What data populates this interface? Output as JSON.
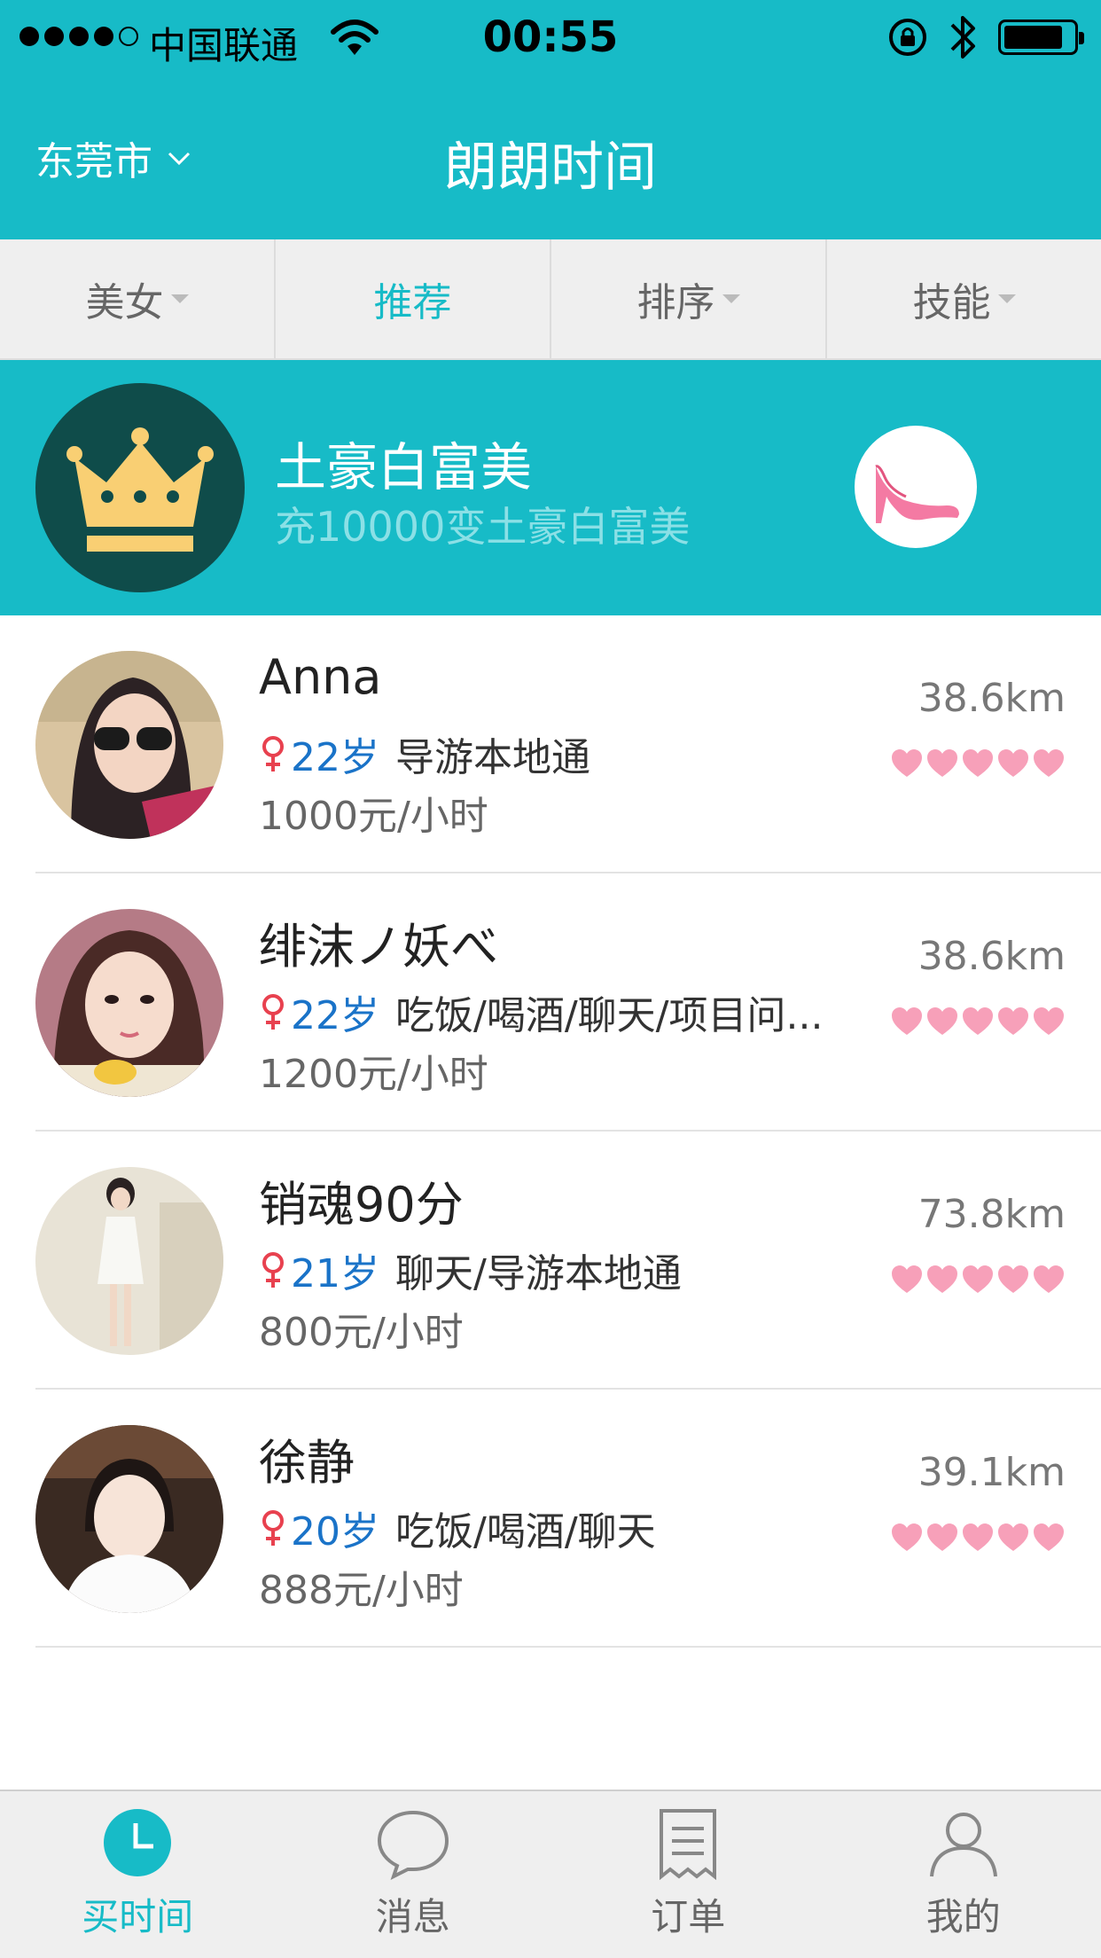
{
  "status": {
    "carrier": "中国联通",
    "time": "00:55",
    "battery_percent": 85
  },
  "header": {
    "city": "东莞市",
    "title": "朗朗时间"
  },
  "filters": [
    {
      "label": "美女",
      "has_dropdown": true,
      "active": false
    },
    {
      "label": "推荐",
      "has_dropdown": false,
      "active": true
    },
    {
      "label": "排序",
      "has_dropdown": true,
      "active": false
    },
    {
      "label": "技能",
      "has_dropdown": true,
      "active": false
    }
  ],
  "banner": {
    "title": "土豪白富美",
    "subtitle": "充10000变土豪白富美",
    "left_icon": "crown-icon",
    "right_icon": "high-heel-icon"
  },
  "profiles": [
    {
      "name": "Anna",
      "age": "22岁",
      "skills": "导游本地通",
      "price": "1000元/小时",
      "distance": "38.6km",
      "rating": 5
    },
    {
      "name": "绯沫ノ妖べ",
      "age": "22岁",
      "skills": "吃饭/喝酒/聊天/项目问...",
      "price": "1200元/小时",
      "distance": "38.6km",
      "rating": 5
    },
    {
      "name": "销魂90分",
      "age": "21岁",
      "skills": "聊天/导游本地通",
      "price": "800元/小时",
      "distance": "73.8km",
      "rating": 5
    },
    {
      "name": "徐静",
      "age": "20岁",
      "skills": "吃饭/喝酒/聊天",
      "price": "888元/小时",
      "distance": "39.1km",
      "rating": 5
    }
  ],
  "tabbar": [
    {
      "label": "买时间",
      "icon": "clock-icon",
      "active": true
    },
    {
      "label": "消息",
      "icon": "chat-bubble-icon",
      "active": false
    },
    {
      "label": "订单",
      "icon": "receipt-icon",
      "active": false
    },
    {
      "label": "我的",
      "icon": "person-icon",
      "active": false
    }
  ],
  "colors": {
    "brand": "#17bbc7",
    "heart": "#f7a0b9",
    "age": "#1a73c8",
    "female": "#e8414f"
  }
}
